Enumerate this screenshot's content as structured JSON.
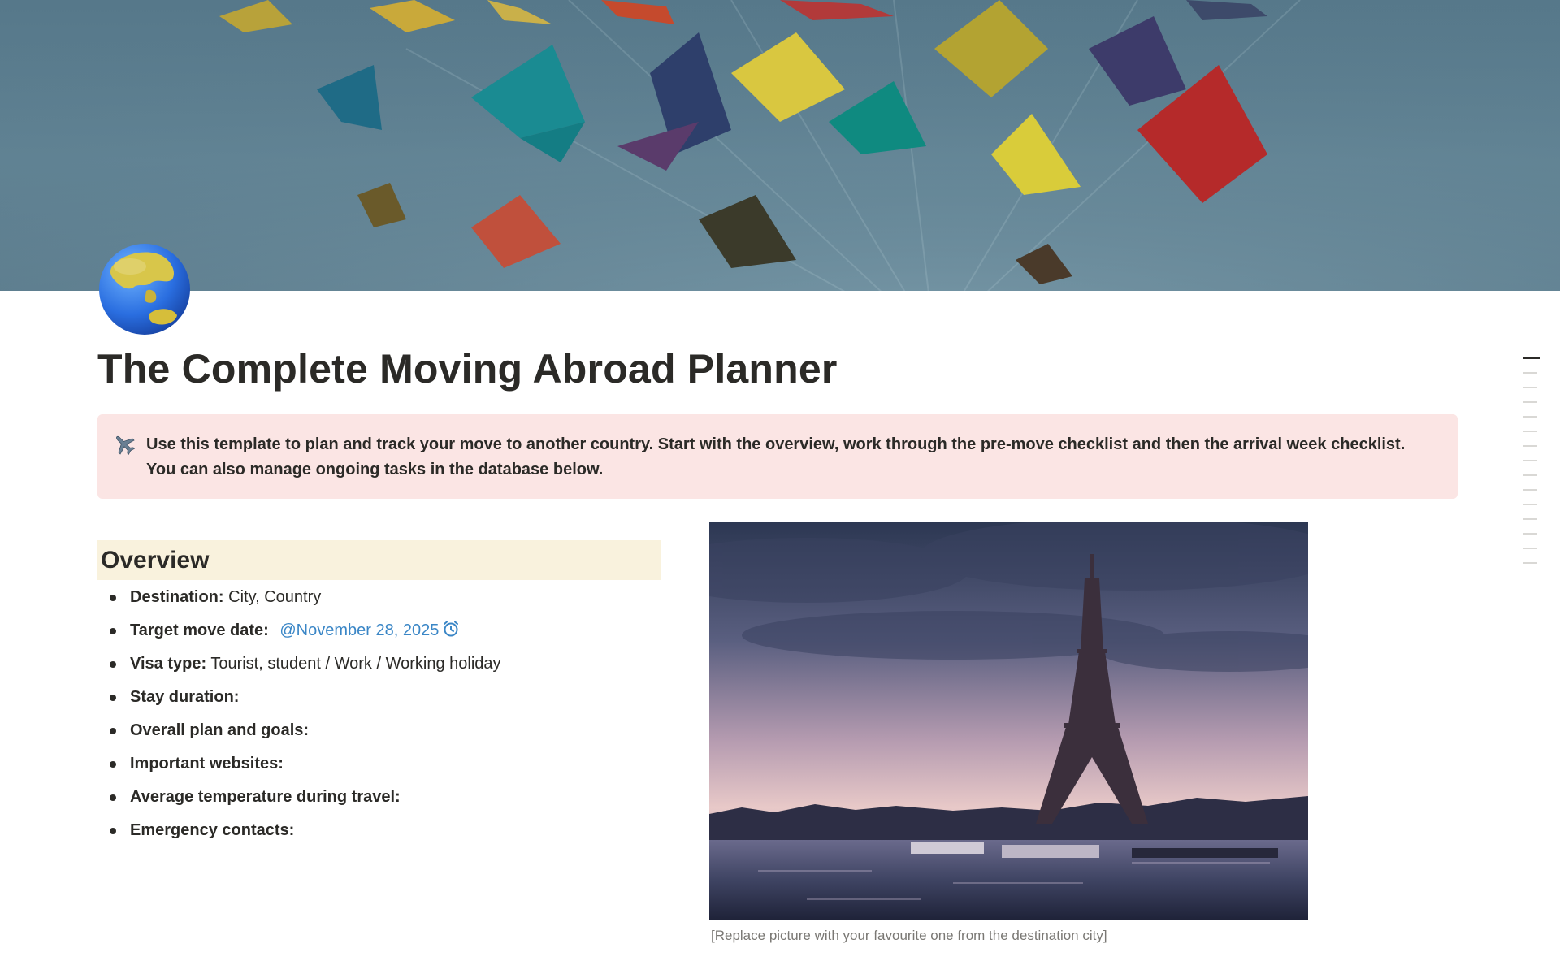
{
  "cover": {
    "image": "origami-cranes-cover",
    "background_color": "#5c7e90"
  },
  "page": {
    "icon": "globe-asia-australia-icon",
    "title": "The Complete Moving Abroad Planner"
  },
  "callout": {
    "icon": "airplane-icon",
    "background_color": "#fbe5e4",
    "text": "Use this template to plan and track your move to another country. Start with the overview, work through the pre-move checklist and then the arrival week checklist. You can also manage ongoing tasks in the database below."
  },
  "overview": {
    "heading": "Overview",
    "heading_background": "#f9f2dd",
    "items": [
      {
        "label": "Destination:",
        "value": "City, Country"
      },
      {
        "label": "Target move date:",
        "mention": "@November 28, 2025",
        "mention_icon": "alarm-clock-icon"
      },
      {
        "label": "Visa type:",
        "value": "Tourist, student / Work / Working holiday"
      },
      {
        "label": "Stay duration:",
        "value": ""
      },
      {
        "label": "Overall plan and goals:",
        "value": ""
      },
      {
        "label": "Important websites:",
        "value": ""
      },
      {
        "label": "Average temperature during travel:",
        "value": ""
      },
      {
        "label": "Emergency contacts:",
        "value": ""
      }
    ]
  },
  "image": {
    "subject": "eiffel-tower-seine-dusk",
    "caption": "[Replace picture with your favourite one from the destination city]"
  },
  "toc": {
    "entries": 15,
    "active_index": 0
  },
  "colors": {
    "text": "#2b2a27",
    "mention": "#3a86c6",
    "caption": "#7a7874"
  }
}
